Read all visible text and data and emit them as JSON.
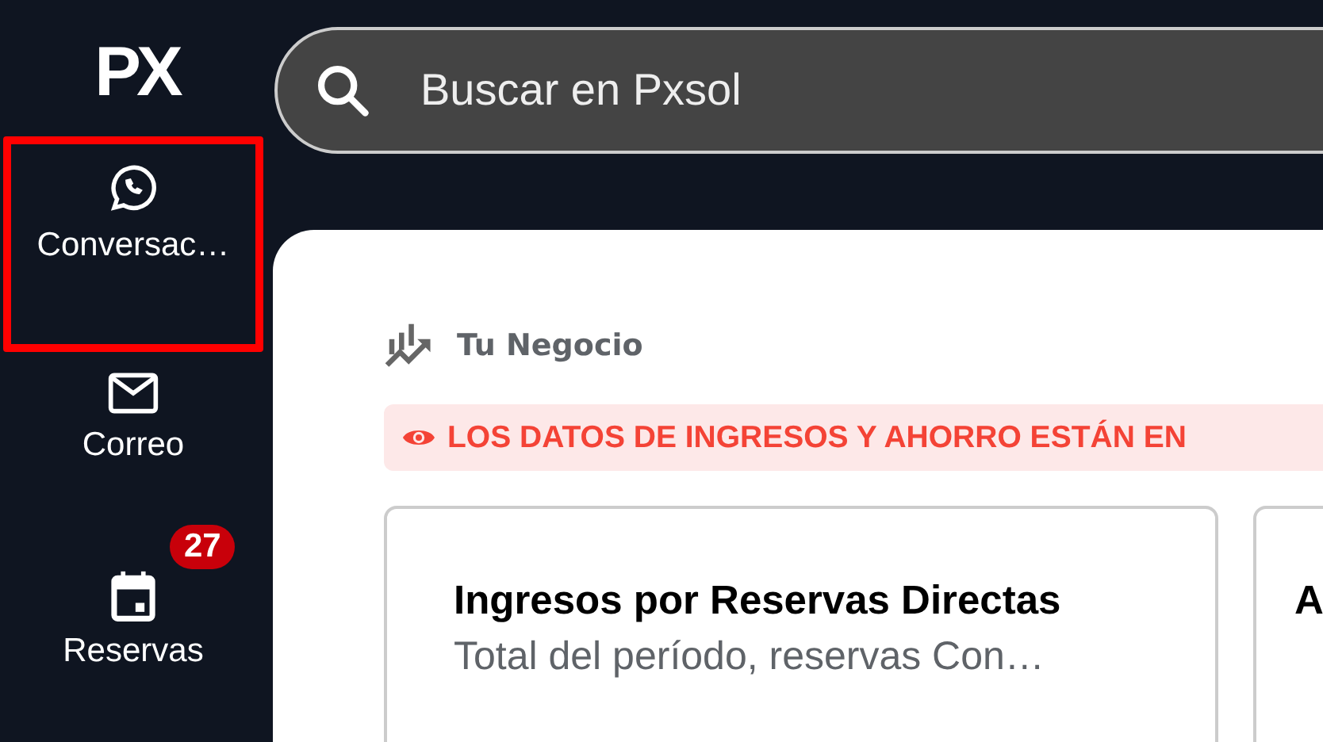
{
  "sidebar": {
    "logo": "PX",
    "items": [
      {
        "kind": "chat",
        "label": "Conversac…",
        "highlighted": true
      },
      {
        "kind": "mail",
        "label": "Correo",
        "highlighted": false
      },
      {
        "kind": "calendar",
        "label": "Reservas",
        "highlighted": false,
        "badge": "27"
      }
    ]
  },
  "search": {
    "placeholder": "Buscar en Pxsol"
  },
  "section": {
    "title": "Tu Negocio"
  },
  "alert": {
    "text": "LOS DATOS DE INGRESOS Y AHORRO ESTÁN EN"
  },
  "cards": [
    {
      "title": "Ingresos por Reservas Directas",
      "subtitle": "Total del período, reservas Con…"
    },
    {
      "title": "A"
    }
  ]
}
